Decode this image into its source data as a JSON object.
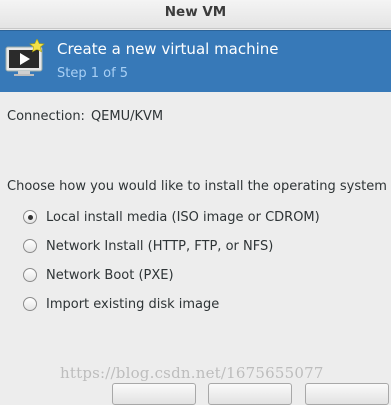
{
  "window": {
    "title": "New VM"
  },
  "header": {
    "title": "Create a new virtual machine",
    "step": "Step 1 of 5",
    "icon": "monitor-star-icon",
    "background_color": "#3779b8"
  },
  "connection": {
    "label": "Connection:",
    "value": "QEMU/KVM"
  },
  "install": {
    "question": "Choose how you would like to install the operating system",
    "options": [
      {
        "label": "Local install media (ISO image or CDROM)",
        "selected": true
      },
      {
        "label": "Network Install (HTTP, FTP, or NFS)",
        "selected": false
      },
      {
        "label": "Network Boot (PXE)",
        "selected": false
      },
      {
        "label": "Import existing disk image",
        "selected": false
      }
    ]
  },
  "watermark": "https://blog.csdn.net/1675655077"
}
